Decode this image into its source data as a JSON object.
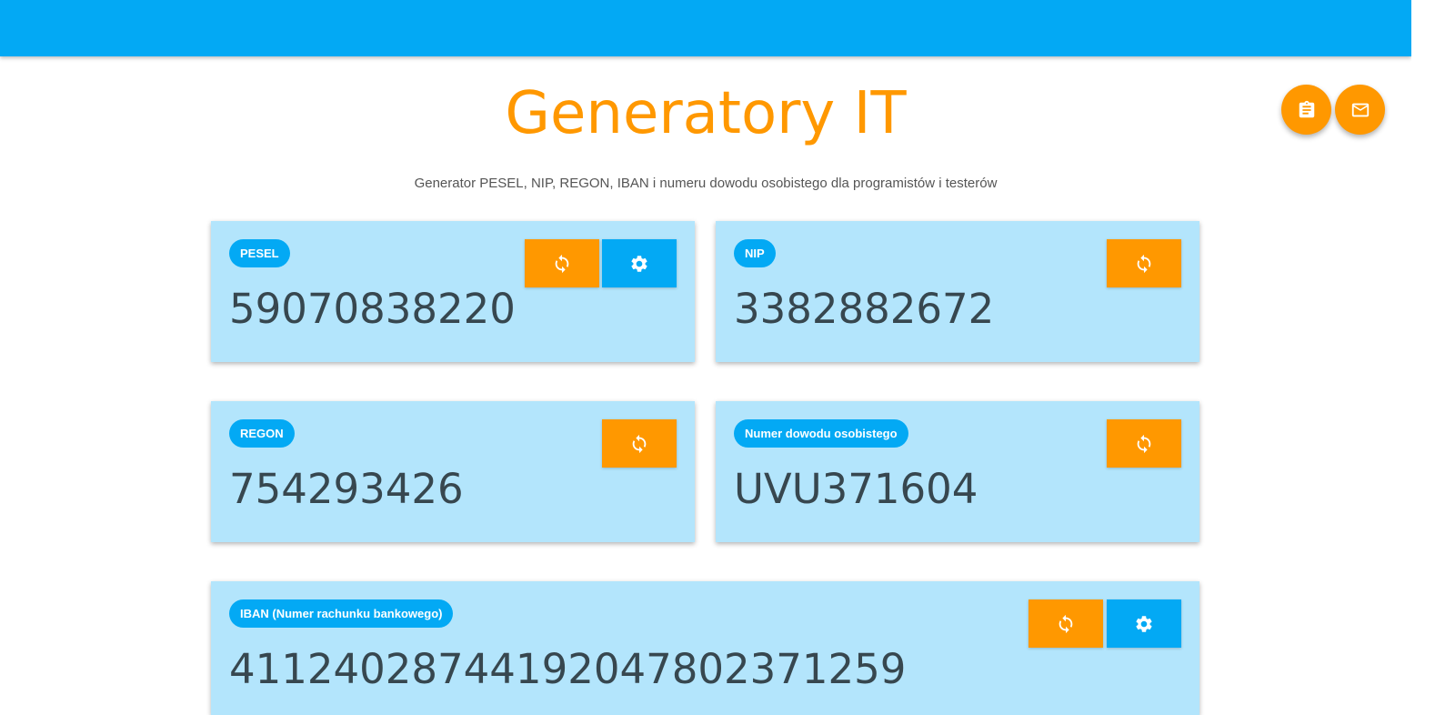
{
  "header": {
    "title": "Generatory IT",
    "subtitle": "Generator PESEL, NIP, REGON, IBAN i numeru dowodu osobistego dla programistów i testerów"
  },
  "fab": {
    "clipboard_icon": "clipboard-icon",
    "mail_icon": "mail-icon"
  },
  "cards": {
    "pesel": {
      "label": "PESEL",
      "value": "59070838220"
    },
    "nip": {
      "label": "NIP",
      "value": "3382882672"
    },
    "regon": {
      "label": "REGON",
      "value": "754293426"
    },
    "dowod": {
      "label": "Numer dowodu osobistego",
      "value": "UVU371604"
    },
    "iban": {
      "label": "IBAN (Numer rachunku bankowego)",
      "value": "41124028744192047802371259"
    }
  },
  "icons": {
    "refresh": "refresh-icon",
    "settings": "gear-icon"
  },
  "colors": {
    "primary": "#03a9f4",
    "accent": "#ff9800",
    "card_bg": "#b3e5fc",
    "value_text": "#37474f"
  }
}
